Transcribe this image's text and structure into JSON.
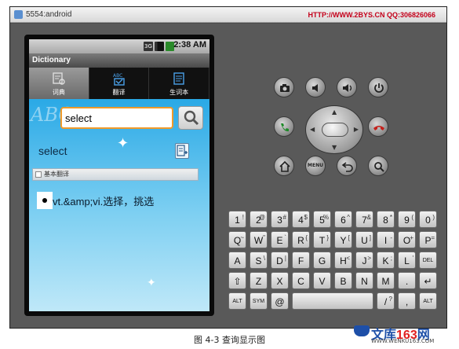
{
  "window": {
    "title": "5554:android",
    "watermark": "HTTP://WWW.2BYS.CN QQ:306826066"
  },
  "statusbar": {
    "network": "3G",
    "time": "2:38 AM"
  },
  "app": {
    "title": "Dictionary",
    "tabs": [
      {
        "label": "词典",
        "icon": "dictionary-icon",
        "active": true
      },
      {
        "label": "翻译",
        "icon": "translate-icon",
        "active": false
      },
      {
        "label": "生词本",
        "icon": "notebook-icon",
        "active": false
      }
    ],
    "search": {
      "value": "select"
    },
    "result": {
      "word": "select",
      "section_label": "基本翻译",
      "definition": "vt.&amp;vi.选择，挑选"
    }
  },
  "keyboard": {
    "rows": [
      [
        {
          "k": "1",
          "a": "!"
        },
        {
          "k": "2",
          "a": "@"
        },
        {
          "k": "3",
          "a": "#"
        },
        {
          "k": "4",
          "a": "$"
        },
        {
          "k": "5",
          "a": "%"
        },
        {
          "k": "6",
          "a": "^"
        },
        {
          "k": "7",
          "a": "&"
        },
        {
          "k": "8",
          "a": "*"
        },
        {
          "k": "9",
          "a": "("
        },
        {
          "k": "0",
          "a": ")"
        }
      ],
      [
        {
          "k": "Q",
          "a": "~"
        },
        {
          "k": "W",
          "a": "\""
        },
        {
          "k": "E",
          "a": "`"
        },
        {
          "k": "R",
          "a": "{"
        },
        {
          "k": "T",
          "a": "}"
        },
        {
          "k": "Y",
          "a": "["
        },
        {
          "k": "U",
          "a": "]"
        },
        {
          "k": "I",
          "a": "-"
        },
        {
          "k": "O",
          "a": "+"
        },
        {
          "k": "P",
          "a": "="
        }
      ],
      [
        {
          "k": "A",
          "a": ""
        },
        {
          "k": "S",
          "a": "\\"
        },
        {
          "k": "D",
          "a": "|"
        },
        {
          "k": "F",
          "a": ""
        },
        {
          "k": "G",
          "a": ""
        },
        {
          "k": "H",
          "a": "<"
        },
        {
          "k": "J",
          "a": ">"
        },
        {
          "k": "K",
          "a": ";"
        },
        {
          "k": "L",
          "a": "'"
        },
        {
          "k": "DEL",
          "a": ""
        }
      ],
      [
        {
          "k": "⇧",
          "a": ""
        },
        {
          "k": "Z",
          "a": ""
        },
        {
          "k": "X",
          "a": ""
        },
        {
          "k": "C",
          "a": ""
        },
        {
          "k": "V",
          "a": ""
        },
        {
          "k": "B",
          "a": ""
        },
        {
          "k": "N",
          "a": ""
        },
        {
          "k": "M",
          "a": ""
        },
        {
          "k": ".",
          "a": ""
        },
        {
          "k": "↵",
          "a": ""
        }
      ],
      [
        {
          "k": "ALT",
          "a": ""
        },
        {
          "k": "SYM",
          "a": ""
        },
        {
          "k": "@",
          "a": ""
        },
        {
          "k": "",
          "a": ""
        },
        {
          "k": "/",
          "a": "?"
        },
        {
          "k": ",",
          "a": ""
        },
        {
          "k": "ALT",
          "a": ""
        }
      ]
    ]
  },
  "caption": "图 4-3 查询显示图",
  "logo": {
    "name_prefix": "文库",
    "name_num": "163",
    "name_suffix": "网",
    "url": "WWW.WENKU163.COM"
  }
}
